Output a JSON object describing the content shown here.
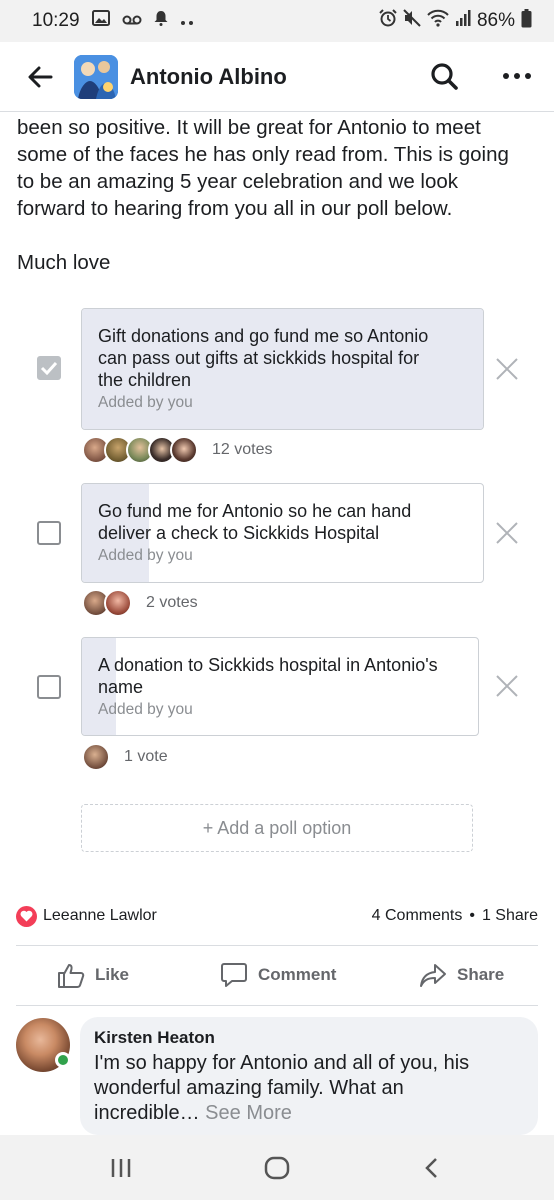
{
  "status_bar": {
    "time": "10:29",
    "battery": "86%"
  },
  "header": {
    "title": "Antonio Albino"
  },
  "post": {
    "lines": [
      "been so positive.  It will be great for Antonio to meet",
      "some of the faces he has only read from. This is going",
      "to be an amazing 5 year celebration and we look",
      "forward to hearing from you all in our poll below."
    ],
    "signoff": "Much love"
  },
  "poll": {
    "options": [
      {
        "label_lines": [
          "Gift donations and go fund me so Antonio",
          "can pass out gifts at sickkids hospital for",
          "the children"
        ],
        "added_by": "Added by you",
        "votes": "12 votes",
        "checked": true,
        "vote_fraction": 0.8
      },
      {
        "label_lines": [
          "Go fund me for Antonio so he can hand",
          "deliver a check to Sickkids Hospital"
        ],
        "added_by": "Added by you",
        "votes": "2 votes",
        "checked": false,
        "vote_fraction": 0.13
      },
      {
        "label_lines": [
          "A donation to Sickkids hospital  in Antonio's",
          "name"
        ],
        "added_by": "Added by you",
        "votes": "1 vote",
        "checked": false,
        "vote_fraction": 0.07
      }
    ],
    "add_option": "+ Add a poll option"
  },
  "reactions": {
    "reactor": "Leeanne Lawlor",
    "comments": "4 Comments",
    "separator": "•",
    "shares": "1 Share"
  },
  "actions": {
    "like": "Like",
    "comment": "Comment",
    "share": "Share"
  },
  "comment": {
    "author": "Kirsten Heaton",
    "text_lines": [
      "I'm so happy for Antonio and all of you, his",
      "wonderful amazing family. What an"
    ],
    "last_line": "incredible…",
    "see_more": "See More"
  },
  "colors": {
    "poll_fill": "#e7e9f2",
    "love": "#f33e58",
    "online": "#31a24c"
  }
}
